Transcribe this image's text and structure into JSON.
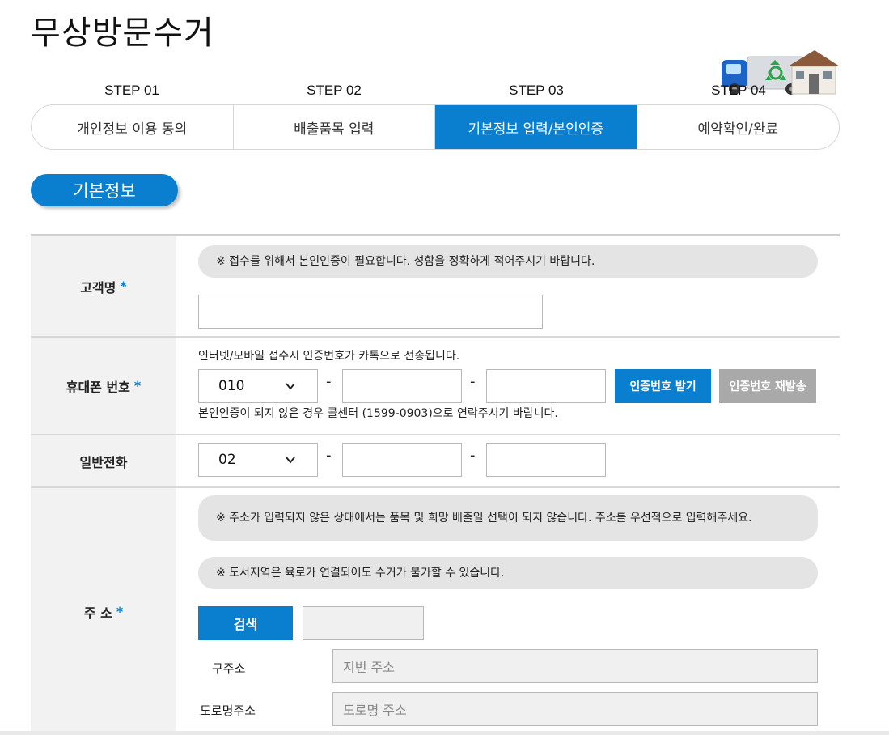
{
  "page": {
    "title": "무상방문수거"
  },
  "steps": [
    {
      "step": "STEP 01",
      "label": "개인정보 이용 동의"
    },
    {
      "step": "STEP 02",
      "label": "배출품목 입력"
    },
    {
      "step": "STEP 03",
      "label": "기본정보 입력/본인인증"
    },
    {
      "step": "STEP 04",
      "label": "예약확인/완료"
    }
  ],
  "section": {
    "title": "기본정보"
  },
  "form": {
    "required_mark": "*",
    "name": {
      "label": "고객명",
      "notice": "※ 접수를 위해서 본인인증이 필요합니다. 성함을 정확하게 적어주시기 바랍니다.",
      "value": ""
    },
    "mobile": {
      "label": "휴대폰 번호",
      "info_top": "인터넷/모바일 접수시 인증번호가 카톡으로 전송됩니다.",
      "prefix": "010",
      "dash": "-",
      "send_button": "인증번호 받기",
      "resend_button": "인증번호 재발송",
      "info_bottom": "본인인증이 되지 않은 경우 콜센터 (1599-0903)으로 연락주시기 바랍니다."
    },
    "phone": {
      "label": "일반전화",
      "prefix": "02",
      "dash": "-"
    },
    "address": {
      "label": "주 소",
      "notice1": "※ 주소가 입력되지 않은 상태에서는 품목 및 희망 배출일 선택이 되지 않습니다. 주소를 우선적으로 입력해주세요.",
      "notice2": "※ 도서지역은 육로가 연결되어도 수거가 불가할 수 있습니다.",
      "search_button": "검색",
      "old_label": "구주소",
      "old_placeholder": "지번 주소",
      "road_label": "도로명주소",
      "road_placeholder": "도로명 주소"
    }
  },
  "colors": {
    "accent": "#0b7fcf",
    "gray_button": "#a9a9a9"
  }
}
